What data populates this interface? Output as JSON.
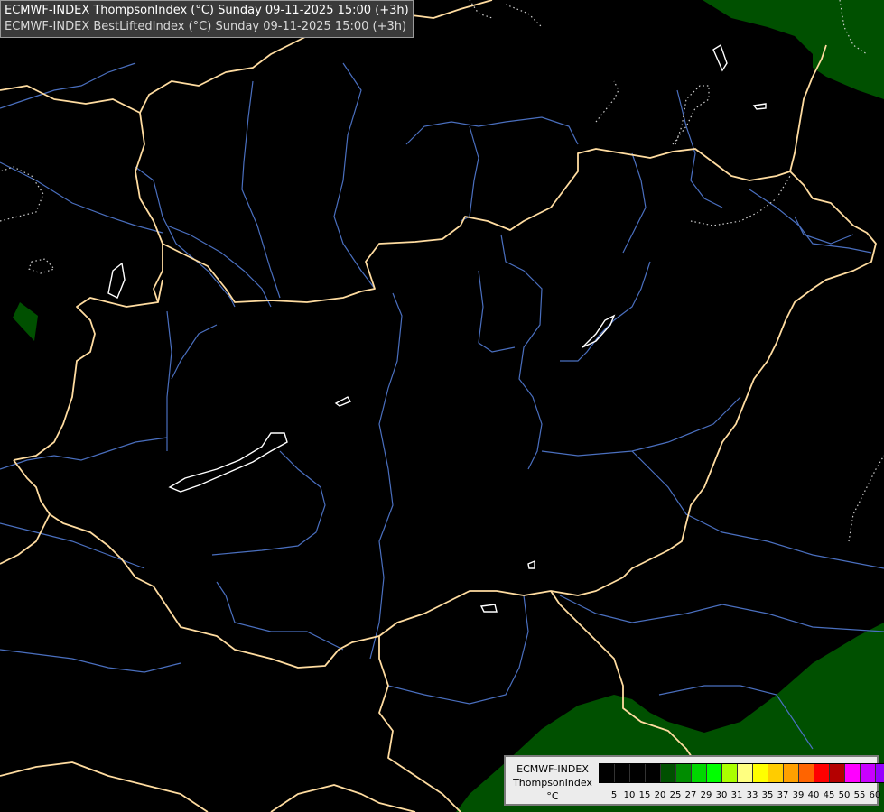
{
  "header": {
    "line1": "ECMWF-INDEX ThompsonIndex (°C) Sunday 09-11-2025 15:00 (+3h)",
    "line2": "ECMWF-INDEX BestLiftedIndex (°C) Sunday 09-11-2025 15:00 (+3h)"
  },
  "legend": {
    "model": "ECMWF-INDEX",
    "parameter": "ThompsonIndex",
    "unit": "°C",
    "colors": [
      "#000000",
      "#000000",
      "#000000",
      "#000000",
      "#005000",
      "#008c00",
      "#00d700",
      "#00ff00",
      "#aaff00",
      "#ffff80",
      "#ffff00",
      "#ffcc00",
      "#ffa000",
      "#ff6400",
      "#ff0000",
      "#b40000",
      "#ff00ff",
      "#c800ff",
      "#9600ff",
      "#6400ff",
      "#0000ff"
    ],
    "ticks": [
      "5",
      "10",
      "15",
      "20",
      "25",
      "27",
      "29",
      "30",
      "31",
      "33",
      "35",
      "37",
      "39",
      "40",
      "45",
      "50",
      "55",
      "60"
    ]
  },
  "colors": {
    "background": "#000000",
    "border": "#ffdca0",
    "river": "#4a6fbf",
    "lake": "#ffffff",
    "isoline": "#cfcfcf",
    "field": "#005000"
  }
}
